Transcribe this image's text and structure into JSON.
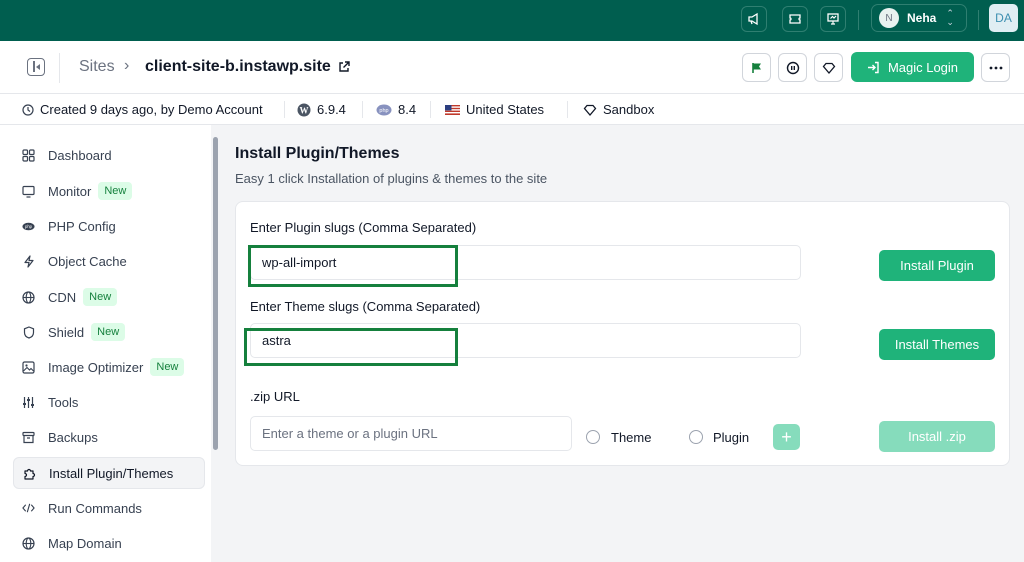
{
  "topbar": {
    "icons": [
      "megaphone-icon",
      "ticket-icon",
      "presentation-icon"
    ],
    "user": {
      "initial": "N",
      "name": "Neha"
    },
    "account_initials": "DA"
  },
  "header": {
    "breadcrumb_sites": "Sites",
    "site_name": "client-site-b.instawp.site",
    "magic_login_label": "Magic Login"
  },
  "info": {
    "created": "Created 9 days ago, by Demo Account",
    "wp_version": "6.9.4",
    "php_version": "8.4",
    "location": "United States",
    "plan": "Sandbox"
  },
  "sidebar": {
    "items": [
      {
        "label": "Dashboard",
        "badge": ""
      },
      {
        "label": "Monitor",
        "badge": "New"
      },
      {
        "label": "PHP Config",
        "badge": ""
      },
      {
        "label": "Object Cache",
        "badge": ""
      },
      {
        "label": "CDN",
        "badge": "New"
      },
      {
        "label": "Shield",
        "badge": "New"
      },
      {
        "label": "Image Optimizer",
        "badge": "New"
      },
      {
        "label": "Tools",
        "badge": ""
      },
      {
        "label": "Backups",
        "badge": ""
      },
      {
        "label": "Install Plugin/Themes",
        "badge": ""
      },
      {
        "label": "Run Commands",
        "badge": ""
      },
      {
        "label": "Map Domain",
        "badge": ""
      }
    ],
    "active": "Install Plugin/Themes"
  },
  "main": {
    "title": "Install Plugin/Themes",
    "subtitle": "Easy 1 click Installation of plugins & themes to the site",
    "plugin_label": "Enter Plugin slugs (Comma Separated)",
    "plugin_value": "wp-all-import",
    "install_plugin_label": "Install Plugin",
    "theme_label": "Enter Theme slugs (Comma Separated)",
    "theme_value": "astra",
    "install_themes_label": "Install Themes",
    "zip_label": ".zip URL",
    "zip_placeholder": "Enter a theme or a plugin URL",
    "radio_theme": "Theme",
    "radio_plugin": "Plugin",
    "plus": "+",
    "install_zip_label": "Install .zip"
  },
  "colors": {
    "topbar": "#005e4f",
    "accent": "#1fb37a",
    "accent_disabled": "#86dcbc",
    "highlight": "#15803d"
  }
}
